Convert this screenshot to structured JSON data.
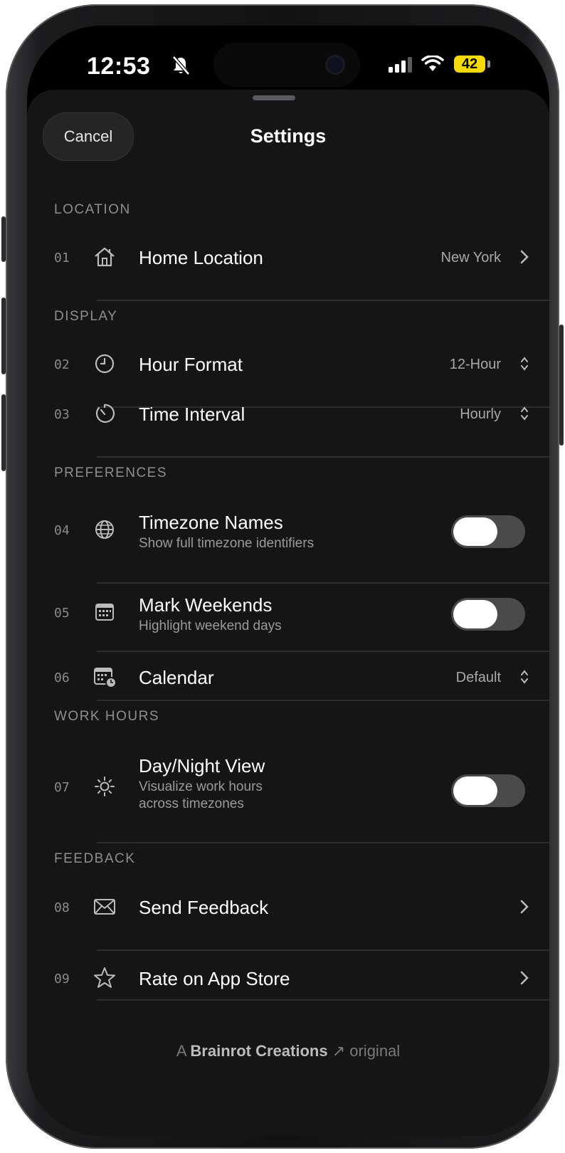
{
  "status_bar": {
    "time": "12:53",
    "battery": "42",
    "battery_color": "#f5d90a"
  },
  "header": {
    "cancel_label": "Cancel",
    "title": "Settings"
  },
  "sections": {
    "location": "LOCATION",
    "display": "DISPLAY",
    "preferences": "PREFERENCES",
    "work_hours": "WORK HOURS",
    "feedback": "FEEDBACK"
  },
  "rows": [
    {
      "num": "01",
      "icon": "house-icon",
      "label": "Home Location",
      "value": "New York",
      "control": "chevron"
    },
    {
      "num": "02",
      "icon": "clock-icon",
      "label": "Hour Format",
      "value": "12-Hour",
      "control": "updown"
    },
    {
      "num": "03",
      "icon": "timer-icon",
      "label": "Time Interval",
      "value": "Hourly",
      "control": "updown"
    },
    {
      "num": "04",
      "icon": "globe-icon",
      "label": "Timezone Names",
      "subtitle": "Show full timezone identifiers",
      "control": "toggle",
      "on": false
    },
    {
      "num": "05",
      "icon": "calendar-icon",
      "label": "Mark Weekends",
      "subtitle": "Highlight weekend days",
      "control": "toggle",
      "on": false
    },
    {
      "num": "06",
      "icon": "calendar-clock-icon",
      "label": "Calendar",
      "value": "Default",
      "control": "updown"
    },
    {
      "num": "07",
      "icon": "sun-icon",
      "label": "Day/Night View",
      "subtitle_line1": "Visualize work hours",
      "subtitle_line2": "across timezones",
      "control": "toggle",
      "on": false
    },
    {
      "num": "08",
      "icon": "envelope-icon",
      "label": "Send Feedback",
      "control": "chevron"
    },
    {
      "num": "09",
      "icon": "star-icon",
      "label": "Rate on App Store",
      "control": "chevron"
    }
  ],
  "footer": {
    "prefix": "A",
    "brand": "Brainrot Creations",
    "arrow": "↗",
    "suffix": "original"
  }
}
